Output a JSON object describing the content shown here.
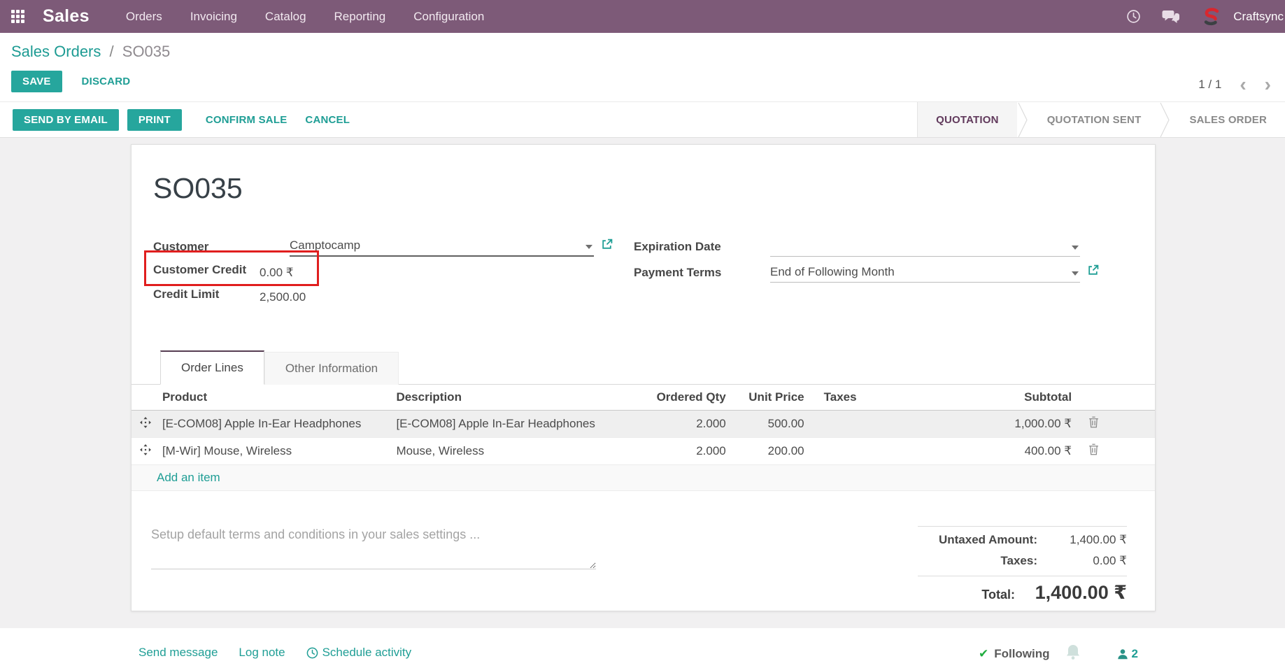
{
  "colors": {
    "navbar": "#7d5a78",
    "accent": "#26a69d",
    "link": "#1f9e95",
    "annotation": "#e01e1e",
    "status_active": "#613a5c"
  },
  "nav": {
    "app_name": "Sales",
    "menus": [
      "Orders",
      "Invoicing",
      "Catalog",
      "Reporting",
      "Configuration"
    ],
    "user_name": "Craftsync"
  },
  "breadcrumb": {
    "parent": "Sales Orders",
    "separator": "/",
    "current": "SO035"
  },
  "control": {
    "save": "SAVE",
    "discard": "DISCARD",
    "pager": "1 / 1",
    "pager_prev": "‹",
    "pager_next": "›"
  },
  "actions": {
    "send_by_email": "SEND BY EMAIL",
    "print": "PRINT",
    "confirm_sale": "CONFIRM SALE",
    "cancel": "CANCEL"
  },
  "statusbar": [
    {
      "label": "QUOTATION",
      "active": true
    },
    {
      "label": "QUOTATION SENT",
      "active": false
    },
    {
      "label": "SALES ORDER",
      "active": false
    }
  ],
  "form": {
    "title": "SO035",
    "fields": {
      "customer": {
        "label": "Customer",
        "value": "Camptocamp"
      },
      "customer_credit": {
        "label": "Customer Credit",
        "value": "0.00 ₹"
      },
      "credit_limit": {
        "label": "Credit Limit",
        "value": "2,500.00"
      },
      "expiration_date": {
        "label": "Expiration Date",
        "value": ""
      },
      "payment_terms": {
        "label": "Payment Terms",
        "value": "End of Following Month"
      }
    },
    "tabs": [
      {
        "label": "Order Lines",
        "active": true
      },
      {
        "label": "Other Information",
        "active": false
      }
    ],
    "order_lines": {
      "columns": [
        "Product",
        "Description",
        "Ordered Qty",
        "Unit Price",
        "Taxes",
        "Subtotal"
      ],
      "rows": [
        {
          "product": "[E-COM08] Apple In-Ear Headphones",
          "description": "[E-COM08] Apple In-Ear Headphones",
          "ordered_qty": "2.000",
          "unit_price": "500.00",
          "taxes": "",
          "subtotal": "1,000.00 ₹"
        },
        {
          "product": "[M-Wir] Mouse, Wireless",
          "description": "Mouse, Wireless",
          "ordered_qty": "2.000",
          "unit_price": "200.00",
          "taxes": "",
          "subtotal": "400.00 ₹"
        }
      ],
      "add_row_label": "Add an item"
    },
    "terms_placeholder": "Setup default terms and conditions in your sales settings ...",
    "totals": {
      "untaxed_label": "Untaxed Amount:",
      "untaxed_value": "1,400.00 ₹",
      "taxes_label": "Taxes:",
      "taxes_value": "0.00 ₹",
      "total_label": "Total:",
      "total_value": "1,400.00 ₹"
    }
  },
  "chatter": {
    "send_message": "Send message",
    "log_note": "Log note",
    "schedule_activity": "Schedule activity",
    "check": "✔",
    "following": "Following",
    "followers_count": "2"
  }
}
